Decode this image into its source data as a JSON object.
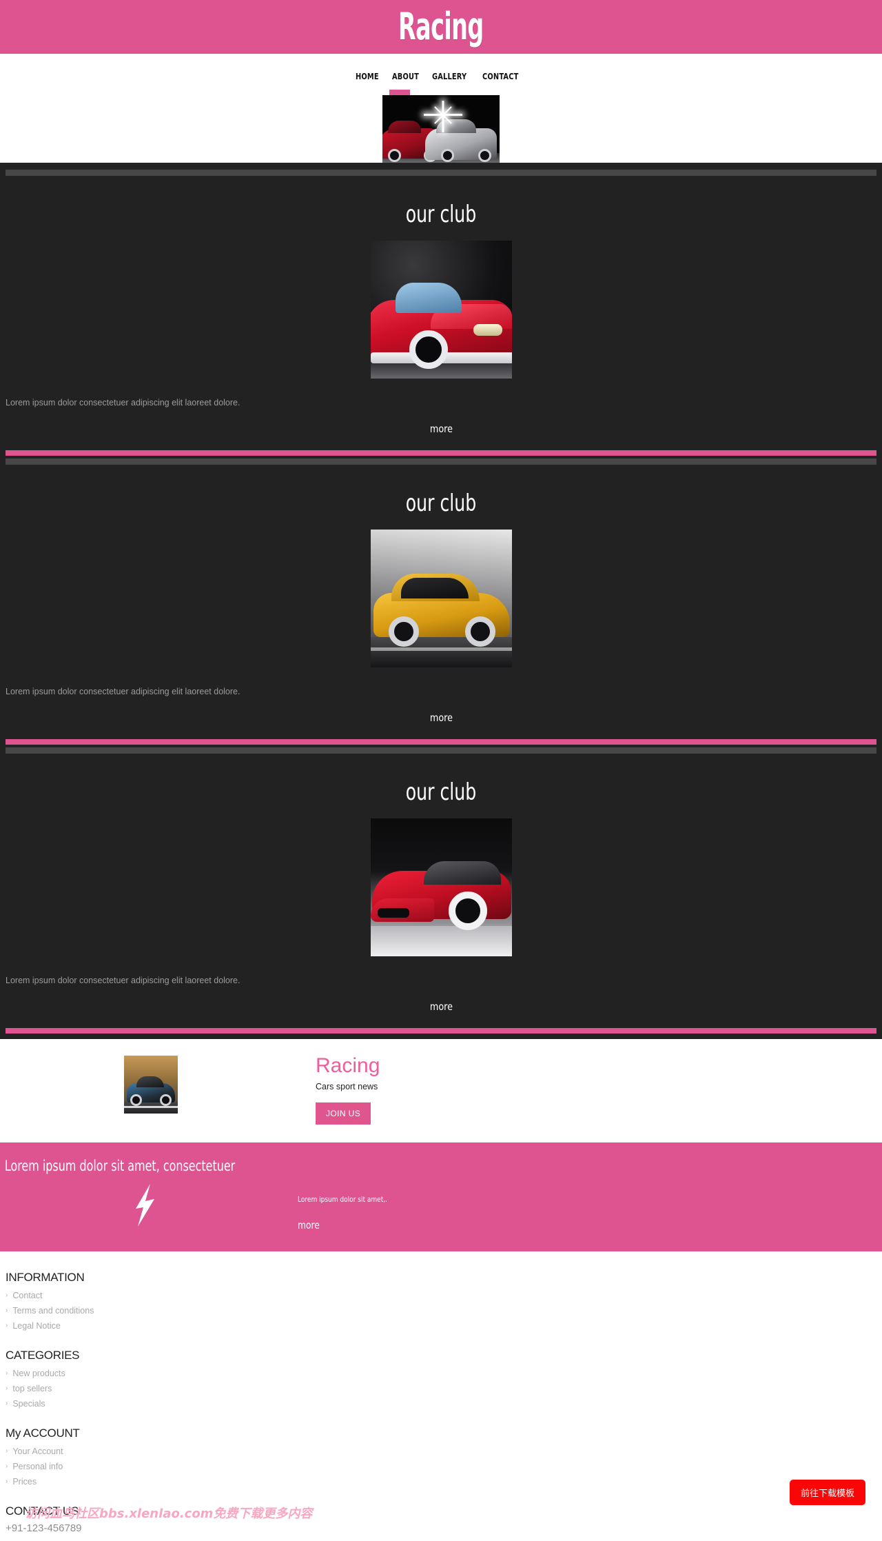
{
  "header": {
    "logo": "Racing",
    "nav": [
      {
        "label": "HOME"
      },
      {
        "label": "ABOUT"
      },
      {
        "label": "GALLERY"
      },
      {
        "label": "CONTACT"
      }
    ]
  },
  "hero": {
    "image_alt": "red-and-silver-sportscars-night"
  },
  "club_sections": [
    {
      "title": "our club",
      "caption": "Lorem ipsum dolor consectetuer adipiscing elit laoreet dolore.",
      "more": "more",
      "image_alt": "red-roadster"
    },
    {
      "title": "our club",
      "caption": "Lorem ipsum dolor consectetuer adipiscing elit laoreet dolore.",
      "more": "more",
      "image_alt": "yellow-hatchback"
    },
    {
      "title": "our club",
      "caption": "Lorem ipsum dolor consectetuer adipiscing elit laoreet dolore.",
      "more": "more",
      "image_alt": "red-sports-coupe"
    }
  ],
  "join": {
    "title": "Racing",
    "subtitle": "Cars sport news",
    "button": "JOIN US",
    "image_alt": "blue-coupe-on-road"
  },
  "promo": {
    "heading": "Lorem ipsum dolor sit amet, consectetuer",
    "text": "Lorem ipsum dolor sit amet,.",
    "more": "more",
    "icon": "lightning-bolt-icon"
  },
  "footer": {
    "blocks": [
      {
        "heading": "INFORMATION",
        "links": [
          "Contact",
          "Terms and conditions",
          "Legal Notice"
        ]
      },
      {
        "heading": "CATEGORIES",
        "links": [
          "New products",
          "top sellers",
          "Specials"
        ]
      },
      {
        "heading": "My ACCOUNT",
        "links": [
          "Your Account",
          "Personal info",
          "Prices"
        ]
      }
    ],
    "contact_heading": "CONTACT US",
    "phone": "+91-123-456789"
  },
  "overlay": {
    "watermark": "访问血鸟社区bbs.xlenlao.com免费下载更多内容",
    "download_button": "前往下载模板"
  },
  "colors": {
    "pink": "#dd5490",
    "pink_title": "#ef5d9e",
    "dark": "#222222",
    "divider_gray": "#474747",
    "red_button": "#fb0606"
  }
}
